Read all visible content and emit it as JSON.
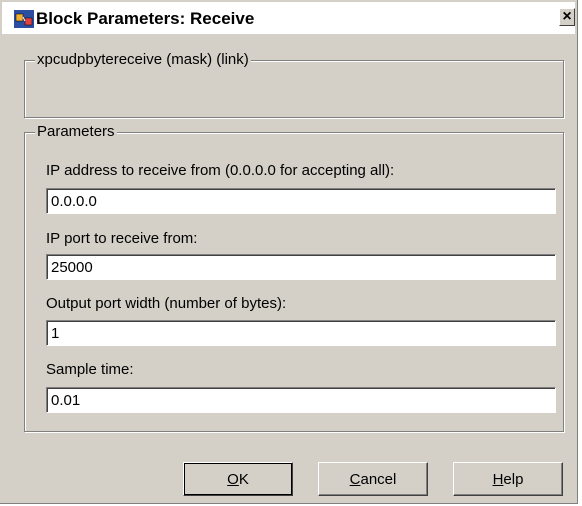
{
  "window": {
    "title": "Block Parameters: Receive",
    "close_label": "×",
    "icon": "simulink-block-icon"
  },
  "mask_group": {
    "legend": "xpcudpbytereceive (mask) (link)"
  },
  "parameters": {
    "legend": "Parameters",
    "fields": [
      {
        "label": "IP address to receive from (0.0.0.0 for accepting all):",
        "value": "0.0.0.0"
      },
      {
        "label": "IP port to receive from:",
        "value": "25000"
      },
      {
        "label": "Output port width (number of bytes):",
        "value": "1"
      },
      {
        "label": "Sample time:",
        "value": "0.01"
      }
    ]
  },
  "buttons": {
    "ok": {
      "mnemonic": "O",
      "rest": "K"
    },
    "cancel": {
      "mnemonic": "C",
      "rest": "ancel"
    },
    "help": {
      "mnemonic": "H",
      "rest": "elp"
    }
  }
}
